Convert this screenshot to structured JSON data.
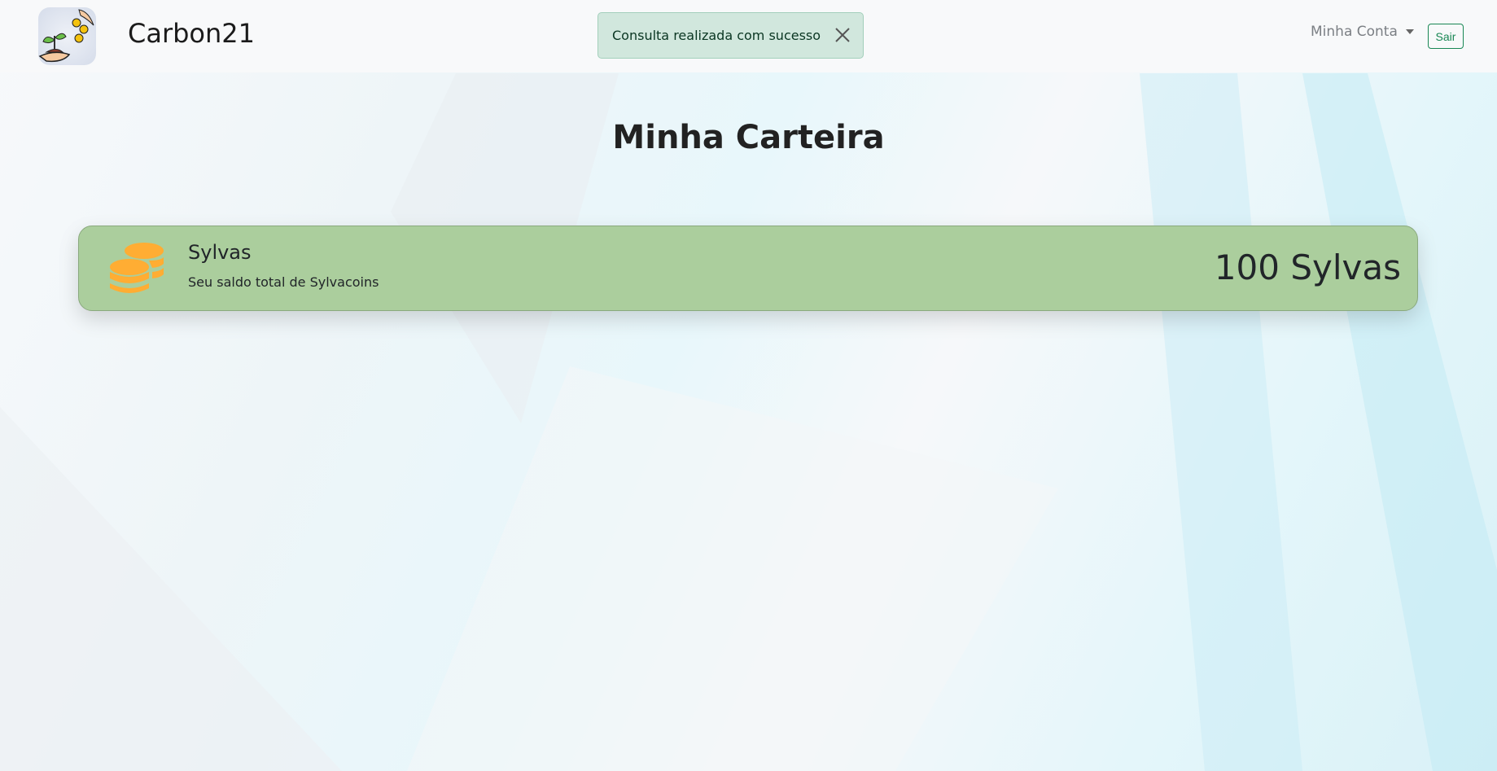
{
  "navbar": {
    "brand": "Carbon21",
    "account_label": "Minha Conta",
    "logout_label": "Sair"
  },
  "toast": {
    "message": "Consulta realizada com sucesso"
  },
  "page": {
    "title": "Minha Carteira"
  },
  "wallet": {
    "name": "Sylvas",
    "description": "Seu saldo total de Sylvacoins",
    "balance": "100 Sylvas",
    "coin_color": "#ffad33",
    "card_color": "#abce9d"
  }
}
